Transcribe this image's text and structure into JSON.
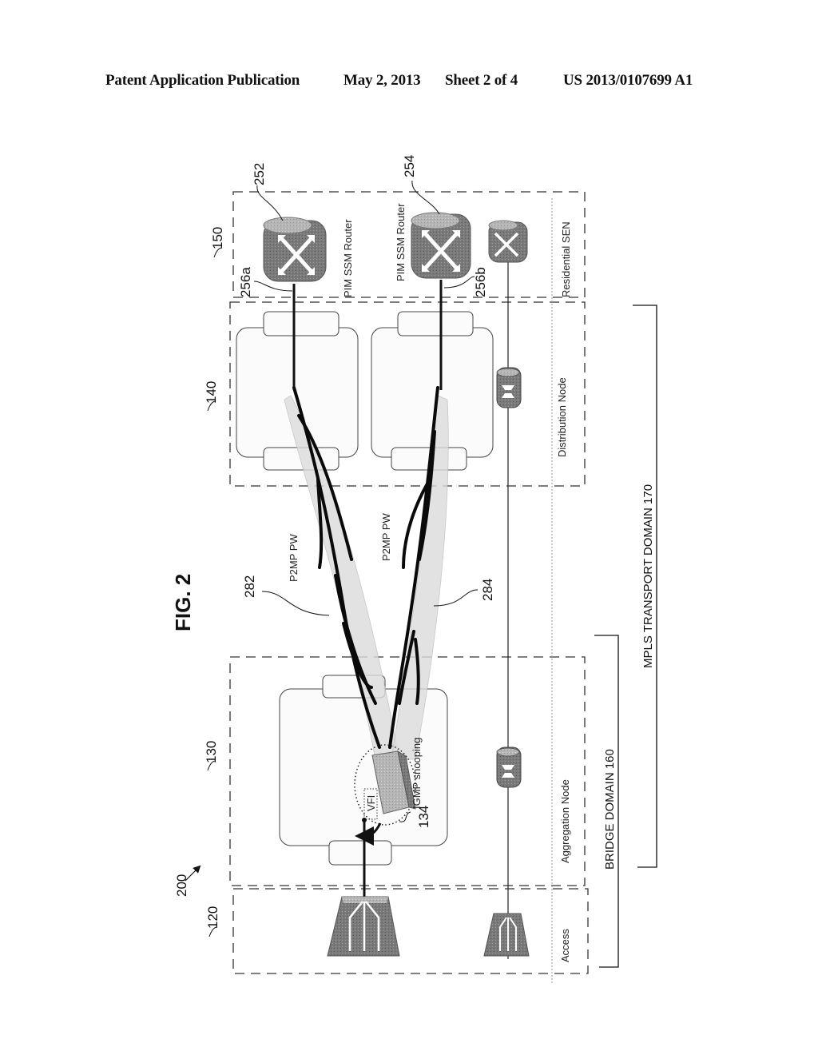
{
  "header": {
    "left": "Patent Application Publication",
    "date": "May 2, 2013",
    "sheet": "Sheet 2 of 4",
    "pub_number": "US 2013/0107699 A1"
  },
  "figure": {
    "title": "FIG. 2",
    "ref_main": "200",
    "regions": [
      {
        "id": "access",
        "ref": "120",
        "label": "Access"
      },
      {
        "id": "aggregation",
        "ref": "130",
        "label": "Aggregation Node"
      },
      {
        "id": "distribution",
        "ref": "140",
        "label": "Distribution Node"
      },
      {
        "id": "sen",
        "ref": "150",
        "label": "Residential SEN"
      }
    ],
    "routers": [
      {
        "ref": "252",
        "label": "PIM SSM Router",
        "port_ref": "256a"
      },
      {
        "ref": "254",
        "label": "PIM SSM Router",
        "port_ref": "256b"
      }
    ],
    "pseudowires": [
      {
        "ref": "282",
        "label": "P2MP PW"
      },
      {
        "ref": "284",
        "label": "P2MP PW"
      }
    ],
    "switch": {
      "ref": "134",
      "label": "IGMP snooping",
      "vfi_label": "VFI"
    },
    "domains": [
      {
        "label": "BRIDGE DOMAIN 160"
      },
      {
        "label": "MPLS TRANSPORT DOMAIN 170"
      }
    ]
  }
}
